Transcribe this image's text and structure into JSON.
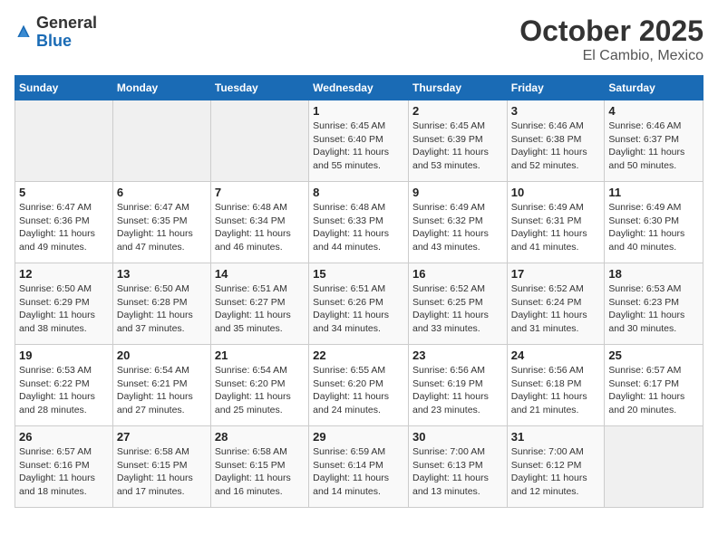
{
  "header": {
    "logo_general": "General",
    "logo_blue": "Blue",
    "month": "October 2025",
    "location": "El Cambio, Mexico"
  },
  "days_of_week": [
    "Sunday",
    "Monday",
    "Tuesday",
    "Wednesday",
    "Thursday",
    "Friday",
    "Saturday"
  ],
  "weeks": [
    [
      {
        "day": "",
        "info": ""
      },
      {
        "day": "",
        "info": ""
      },
      {
        "day": "",
        "info": ""
      },
      {
        "day": "1",
        "info": "Sunrise: 6:45 AM\nSunset: 6:40 PM\nDaylight: 11 hours\nand 55 minutes."
      },
      {
        "day": "2",
        "info": "Sunrise: 6:45 AM\nSunset: 6:39 PM\nDaylight: 11 hours\nand 53 minutes."
      },
      {
        "day": "3",
        "info": "Sunrise: 6:46 AM\nSunset: 6:38 PM\nDaylight: 11 hours\nand 52 minutes."
      },
      {
        "day": "4",
        "info": "Sunrise: 6:46 AM\nSunset: 6:37 PM\nDaylight: 11 hours\nand 50 minutes."
      }
    ],
    [
      {
        "day": "5",
        "info": "Sunrise: 6:47 AM\nSunset: 6:36 PM\nDaylight: 11 hours\nand 49 minutes."
      },
      {
        "day": "6",
        "info": "Sunrise: 6:47 AM\nSunset: 6:35 PM\nDaylight: 11 hours\nand 47 minutes."
      },
      {
        "day": "7",
        "info": "Sunrise: 6:48 AM\nSunset: 6:34 PM\nDaylight: 11 hours\nand 46 minutes."
      },
      {
        "day": "8",
        "info": "Sunrise: 6:48 AM\nSunset: 6:33 PM\nDaylight: 11 hours\nand 44 minutes."
      },
      {
        "day": "9",
        "info": "Sunrise: 6:49 AM\nSunset: 6:32 PM\nDaylight: 11 hours\nand 43 minutes."
      },
      {
        "day": "10",
        "info": "Sunrise: 6:49 AM\nSunset: 6:31 PM\nDaylight: 11 hours\nand 41 minutes."
      },
      {
        "day": "11",
        "info": "Sunrise: 6:49 AM\nSunset: 6:30 PM\nDaylight: 11 hours\nand 40 minutes."
      }
    ],
    [
      {
        "day": "12",
        "info": "Sunrise: 6:50 AM\nSunset: 6:29 PM\nDaylight: 11 hours\nand 38 minutes."
      },
      {
        "day": "13",
        "info": "Sunrise: 6:50 AM\nSunset: 6:28 PM\nDaylight: 11 hours\nand 37 minutes."
      },
      {
        "day": "14",
        "info": "Sunrise: 6:51 AM\nSunset: 6:27 PM\nDaylight: 11 hours\nand 35 minutes."
      },
      {
        "day": "15",
        "info": "Sunrise: 6:51 AM\nSunset: 6:26 PM\nDaylight: 11 hours\nand 34 minutes."
      },
      {
        "day": "16",
        "info": "Sunrise: 6:52 AM\nSunset: 6:25 PM\nDaylight: 11 hours\nand 33 minutes."
      },
      {
        "day": "17",
        "info": "Sunrise: 6:52 AM\nSunset: 6:24 PM\nDaylight: 11 hours\nand 31 minutes."
      },
      {
        "day": "18",
        "info": "Sunrise: 6:53 AM\nSunset: 6:23 PM\nDaylight: 11 hours\nand 30 minutes."
      }
    ],
    [
      {
        "day": "19",
        "info": "Sunrise: 6:53 AM\nSunset: 6:22 PM\nDaylight: 11 hours\nand 28 minutes."
      },
      {
        "day": "20",
        "info": "Sunrise: 6:54 AM\nSunset: 6:21 PM\nDaylight: 11 hours\nand 27 minutes."
      },
      {
        "day": "21",
        "info": "Sunrise: 6:54 AM\nSunset: 6:20 PM\nDaylight: 11 hours\nand 25 minutes."
      },
      {
        "day": "22",
        "info": "Sunrise: 6:55 AM\nSunset: 6:20 PM\nDaylight: 11 hours\nand 24 minutes."
      },
      {
        "day": "23",
        "info": "Sunrise: 6:56 AM\nSunset: 6:19 PM\nDaylight: 11 hours\nand 23 minutes."
      },
      {
        "day": "24",
        "info": "Sunrise: 6:56 AM\nSunset: 6:18 PM\nDaylight: 11 hours\nand 21 minutes."
      },
      {
        "day": "25",
        "info": "Sunrise: 6:57 AM\nSunset: 6:17 PM\nDaylight: 11 hours\nand 20 minutes."
      }
    ],
    [
      {
        "day": "26",
        "info": "Sunrise: 6:57 AM\nSunset: 6:16 PM\nDaylight: 11 hours\nand 18 minutes."
      },
      {
        "day": "27",
        "info": "Sunrise: 6:58 AM\nSunset: 6:15 PM\nDaylight: 11 hours\nand 17 minutes."
      },
      {
        "day": "28",
        "info": "Sunrise: 6:58 AM\nSunset: 6:15 PM\nDaylight: 11 hours\nand 16 minutes."
      },
      {
        "day": "29",
        "info": "Sunrise: 6:59 AM\nSunset: 6:14 PM\nDaylight: 11 hours\nand 14 minutes."
      },
      {
        "day": "30",
        "info": "Sunrise: 7:00 AM\nSunset: 6:13 PM\nDaylight: 11 hours\nand 13 minutes."
      },
      {
        "day": "31",
        "info": "Sunrise: 7:00 AM\nSunset: 6:12 PM\nDaylight: 11 hours\nand 12 minutes."
      },
      {
        "day": "",
        "info": ""
      }
    ]
  ]
}
